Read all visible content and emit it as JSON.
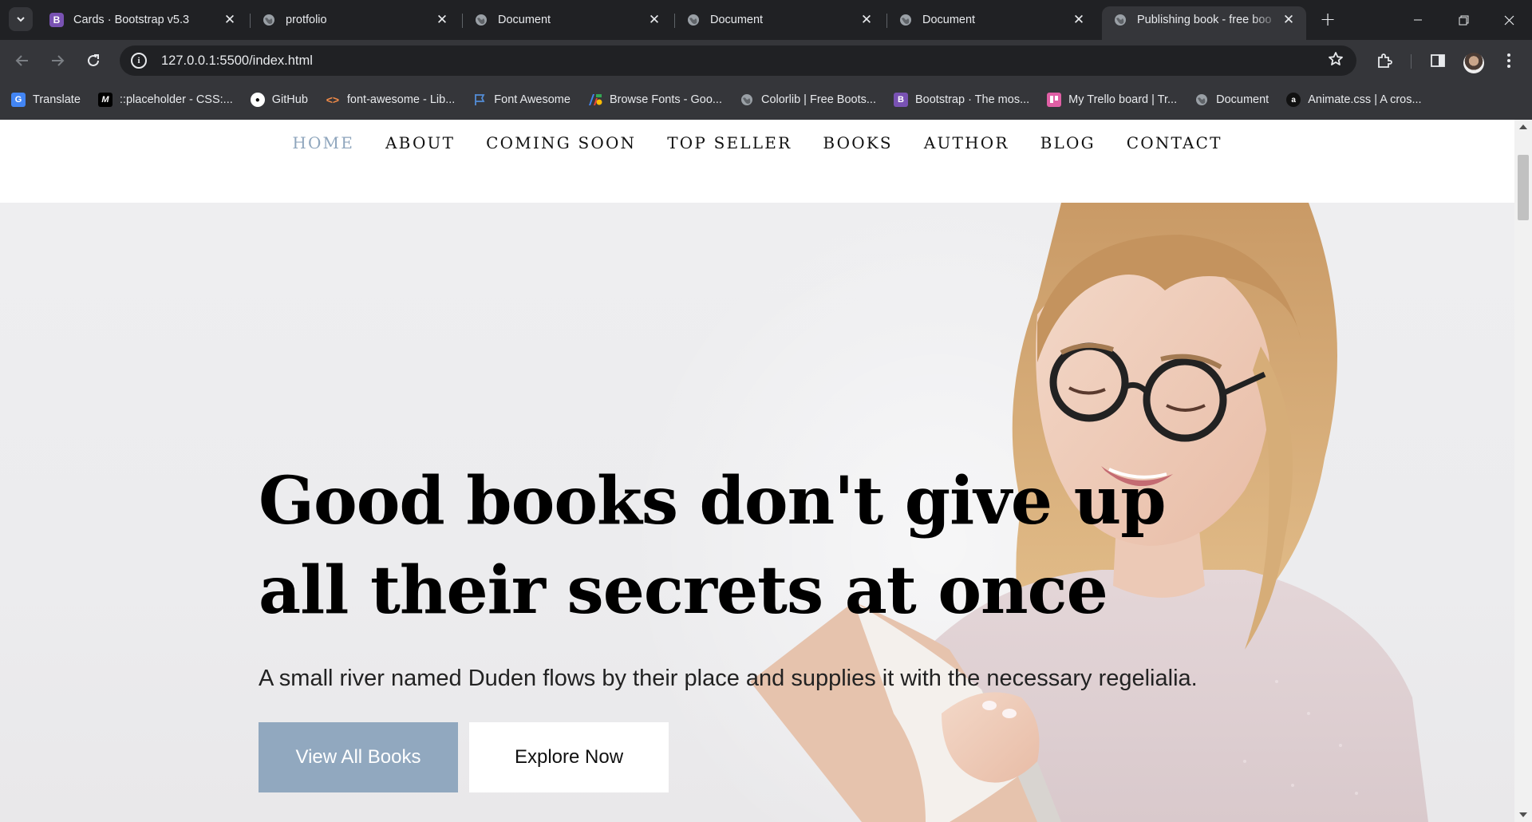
{
  "browser": {
    "tabs": [
      {
        "title": "Cards · Bootstrap v5.3",
        "favicon": "bootstrap-icon",
        "active": false
      },
      {
        "title": "protfolio",
        "favicon": "globe-icon",
        "active": false
      },
      {
        "title": "Document",
        "favicon": "globe-icon",
        "active": false
      },
      {
        "title": "Document",
        "favicon": "globe-icon",
        "active": false
      },
      {
        "title": "Document",
        "favicon": "globe-icon",
        "active": false
      },
      {
        "title": "Publishing book - free boo",
        "favicon": "globe-icon",
        "active": true
      }
    ],
    "url": "127.0.0.1:5500/index.html",
    "bookmarks": [
      {
        "label": "Translate",
        "icon": "google-translate-icon"
      },
      {
        "label": "::placeholder - CSS:...",
        "icon": "mdn-icon"
      },
      {
        "label": "GitHub",
        "icon": "github-icon"
      },
      {
        "label": "font-awesome - Lib...",
        "icon": "code-icon"
      },
      {
        "label": "Font Awesome",
        "icon": "flag-icon"
      },
      {
        "label": "Browse Fonts - Goo...",
        "icon": "google-fonts-icon"
      },
      {
        "label": "Colorlib | Free Boots...",
        "icon": "globe-icon"
      },
      {
        "label": "Bootstrap · The mos...",
        "icon": "bootstrap-icon"
      },
      {
        "label": "My Trello board | Tr...",
        "icon": "trello-icon"
      },
      {
        "label": "Document",
        "icon": "globe-icon"
      },
      {
        "label": "Animate.css | A cros...",
        "icon": "animate-icon"
      }
    ]
  },
  "site": {
    "nav": [
      {
        "label": "HOME",
        "active": true
      },
      {
        "label": "ABOUT",
        "active": false
      },
      {
        "label": "COMING SOON",
        "active": false
      },
      {
        "label": "TOP SELLER",
        "active": false
      },
      {
        "label": "BOOKS",
        "active": false
      },
      {
        "label": "AUTHOR",
        "active": false
      },
      {
        "label": "BLOG",
        "active": false
      },
      {
        "label": "CONTACT",
        "active": false
      }
    ],
    "hero": {
      "title_line1": "Good books don't give up",
      "title_line2": "all their secrets at once",
      "subtitle": "A small river named Duden flows by their place and supplies it with the necessary regelialia.",
      "primary_button": "View All Books",
      "secondary_button": "Explore Now"
    }
  },
  "colors": {
    "accent": "#91a8bf",
    "nav_active": "#8fa6bd",
    "chrome_dark": "#202124",
    "chrome_toolbar": "#35363a"
  }
}
